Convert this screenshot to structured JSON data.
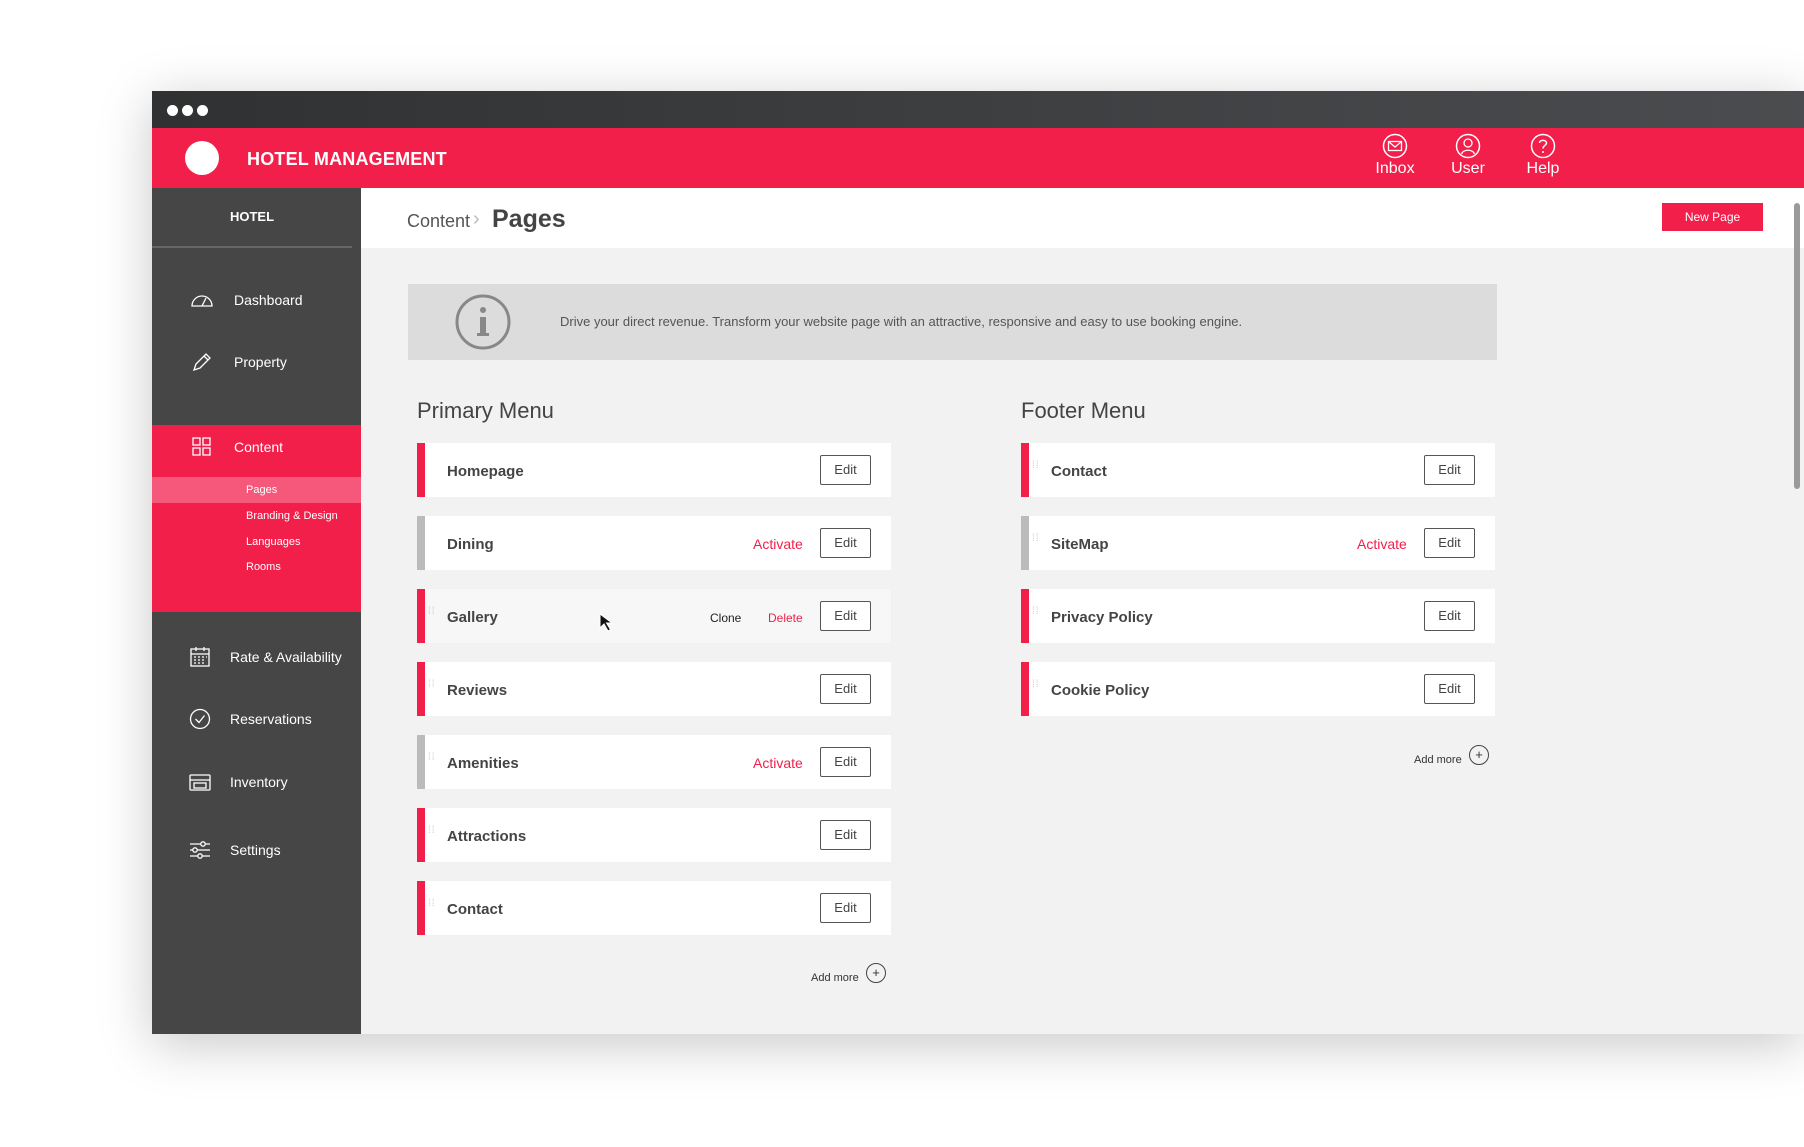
{
  "app": {
    "brand": "HOTEL MANAGEMENT"
  },
  "topnav": {
    "inbox": "Inbox",
    "user": "User",
    "help": "Help"
  },
  "sidebar": {
    "header": "HOTEL",
    "items": [
      {
        "label": "Dashboard",
        "icon": "gauge-icon"
      },
      {
        "label": "Property",
        "icon": "pencil-icon"
      },
      {
        "label": "Content",
        "icon": "grid-icon"
      },
      {
        "label": "Rate & Availability",
        "icon": "calendar-icon"
      },
      {
        "label": "Reservations",
        "icon": "check-circle-icon"
      },
      {
        "label": "Inventory",
        "icon": "box-icon"
      },
      {
        "label": "Settings",
        "icon": "sliders-icon"
      }
    ],
    "content_subitems": [
      "Pages",
      "Branding & Design",
      "Languages",
      "Rooms"
    ],
    "active_subitem": "Pages"
  },
  "header": {
    "breadcrumb": "Content",
    "title": "Pages",
    "new_page": "New Page"
  },
  "info": {
    "text": "Drive your direct revenue. Transform your website page with an attractive, responsive and easy to use booking engine."
  },
  "primary": {
    "title": "Primary Menu",
    "rows": [
      {
        "name": "Homepage",
        "edit": "Edit"
      },
      {
        "name": "Dining",
        "activate": "Activate",
        "edit": "Edit"
      },
      {
        "name": "Gallery",
        "clone": "Clone",
        "delete": "Delete",
        "edit": "Edit"
      },
      {
        "name": "Reviews",
        "edit": "Edit"
      },
      {
        "name": "Amenities",
        "activate": "Activate",
        "edit": "Edit"
      },
      {
        "name": "Attractions",
        "edit": "Edit"
      },
      {
        "name": "Contact",
        "edit": "Edit"
      }
    ],
    "add_more": "Add more"
  },
  "footer": {
    "title": "Footer Menu",
    "rows": [
      {
        "name": "Contact",
        "edit": "Edit"
      },
      {
        "name": "SiteMap",
        "activate": "Activate",
        "edit": "Edit"
      },
      {
        "name": "Privacy Policy",
        "edit": "Edit"
      },
      {
        "name": "Cookie Policy",
        "edit": "Edit"
      }
    ],
    "add_more": "Add more"
  },
  "colors": {
    "accent": "#f21f4a",
    "sidebar": "#464646",
    "inactive_bar": "#bbbbbb"
  }
}
